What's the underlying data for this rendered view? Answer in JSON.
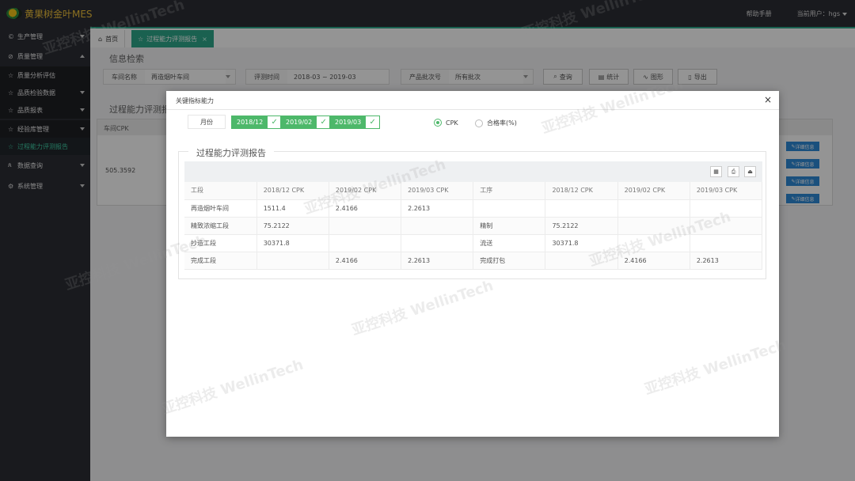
{
  "app": {
    "brand": "黄果树金叶MES",
    "help": "帮助手册",
    "current_user_label": "当前用户：",
    "user": "hgs"
  },
  "sidebar": {
    "items": [
      {
        "icon": "©",
        "label": "生产管理"
      },
      {
        "icon": "⊘",
        "label": "质量管理"
      },
      {
        "icon": "☆",
        "label": "质量分析评估"
      },
      {
        "icon": "☆",
        "label": "品质检验数据"
      },
      {
        "icon": "☆",
        "label": "品质报表"
      },
      {
        "icon": "☆",
        "label": "经验库管理"
      },
      {
        "icon": "☆",
        "label": "过程能力评测报告"
      },
      {
        "icon": "ጰ",
        "label": "数据查询"
      },
      {
        "icon": "⚙",
        "label": "系统管理"
      }
    ]
  },
  "tabs": {
    "home": "首页",
    "current": "过程能力评测报告"
  },
  "main": {
    "search_title": "信息检索",
    "filters": {
      "workshop_label": "车间名称",
      "workshop_value": "再造烟叶车间",
      "time_label": "评测时间",
      "time_value": "2018-03 ~ 2019-03",
      "batch_label": "产品批次号",
      "batch_value": "所有批次"
    },
    "buttons": {
      "query": "查询",
      "stats": "统计",
      "chart": "图形",
      "export": "导出"
    },
    "panel_title": "过程能力评测报",
    "panel_header": "车间CPK",
    "panel_value": "505.3592",
    "detail_label": "详细信息"
  },
  "modal": {
    "title": "关键指标能力",
    "month_label": "月份",
    "months": [
      "2018/12",
      "2019/02",
      "2019/03"
    ],
    "radio_cpk": "CPK",
    "radio_pass": "合格率(%)",
    "report_title": "过程能力评测报告",
    "table": {
      "headers": [
        "工段",
        "2018/12 CPK",
        "2019/02 CPK",
        "2019/03 CPK",
        "工序",
        "2018/12 CPK",
        "2019/02 CPK",
        "2019/03 CPK"
      ],
      "rows": [
        [
          "再造烟叶车间",
          "1511.4",
          "2.4166",
          "2.2613",
          "",
          "",
          "",
          ""
        ],
        [
          "精致浓缩工段",
          "75.2122",
          "",
          "",
          "精制",
          "75.2122",
          "",
          ""
        ],
        [
          "抄造工段",
          "30371.8",
          "",
          "",
          "流送",
          "30371.8",
          "",
          ""
        ],
        [
          "完成工段",
          "",
          "2.4166",
          "2.2613",
          "完成打包",
          "",
          "2.4166",
          "2.2613"
        ]
      ]
    }
  },
  "watermark": "亚控科技 WellinTech"
}
